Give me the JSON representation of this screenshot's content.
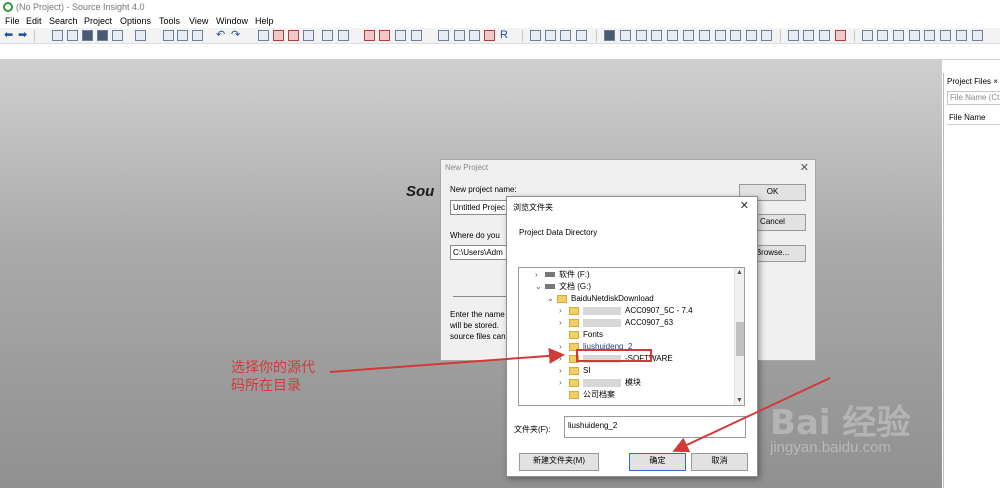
{
  "window": {
    "title": "(No Project) - Source Insight 4.0"
  },
  "menu": [
    "File",
    "Edit",
    "Search",
    "Project",
    "Options",
    "Tools",
    "View",
    "Window",
    "Help"
  ],
  "editor": {
    "brand_text": "Sou"
  },
  "right_panel": {
    "tab_label": "Project Files ×",
    "filter_placeholder": "File Name (Ct",
    "column_header": "File Name"
  },
  "new_project_dialog": {
    "title": "New Project",
    "name_label": "New project name:",
    "name_value": "Untitled Projec",
    "where_label": "Where do you",
    "where_value": "C:\\Users\\Adm",
    "info_lines": [
      "Enter the name",
      "will be stored.",
      "source files can"
    ],
    "ok": "OK",
    "cancel": "Cancel",
    "browse": "Browse..."
  },
  "browse_dialog": {
    "title": "浏览文件夹",
    "heading": "Project Data Directory",
    "tree": [
      {
        "label": "软件 (F:)",
        "kind": "drive"
      },
      {
        "label": "文档 (G:)",
        "kind": "drive"
      },
      {
        "label": "BaiduNetdiskDownload",
        "kind": "folder"
      },
      {
        "label": "ACC0907_5C - 7.4",
        "kind": "folder"
      },
      {
        "label": "ACC0907_63",
        "kind": "folder"
      },
      {
        "label": "Fonts",
        "kind": "folder"
      },
      {
        "label": "liushuideng_2",
        "kind": "folder",
        "selected": true
      },
      {
        "label": "-SOFTWARE",
        "kind": "folder"
      },
      {
        "label": "SI",
        "kind": "folder"
      },
      {
        "label": "模块",
        "kind": "folder"
      },
      {
        "label": "公司档案",
        "kind": "folder"
      }
    ],
    "folder_label": "文件夹(F):",
    "folder_value": "liushuideng_2",
    "new_folder": "新建文件夹(M)",
    "ok": "确定",
    "cancel": "取消"
  },
  "annotation": {
    "line1": "选择你的源代",
    "line2": "码所在目录",
    "color": "#d23a3a"
  },
  "watermark": {
    "logo": "Bai 经验",
    "url": "jingyan.baidu.com"
  }
}
